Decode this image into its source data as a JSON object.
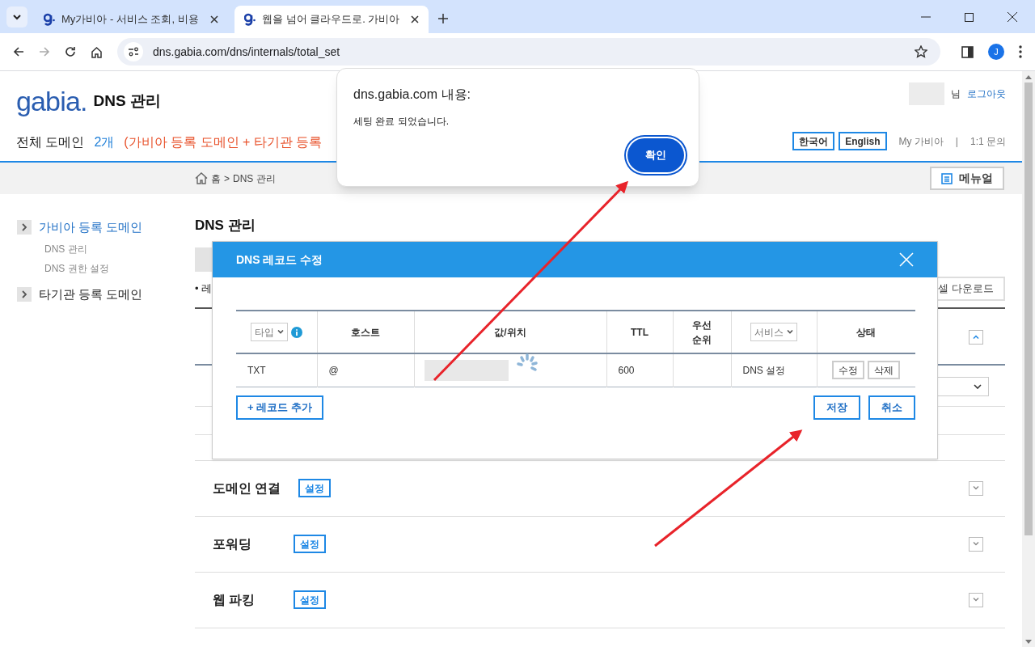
{
  "browser": {
    "tabs": [
      {
        "title": "My가비아 - 서비스 조회, 비용",
        "selected": false
      },
      {
        "title": "웹을 넘어 클라우드로. 가비아",
        "selected": true
      }
    ],
    "url": "dns.gabia.com/dns/internals/total_set",
    "avatar": "J"
  },
  "header": {
    "logo": "gabia.",
    "title": "DNS 관리",
    "user_suffix": "님",
    "logout": "로그아웃"
  },
  "summary": {
    "label": "전체 도메인",
    "count": "2개",
    "note": "(가비아 등록 도메인 + 타기관 등록"
  },
  "languages": [
    {
      "label": "한국어"
    },
    {
      "label": "English"
    }
  ],
  "links": [
    "My 가비아",
    "|",
    "1:1 문의"
  ],
  "breadcrumb": {
    "home": "홈",
    "separator": ">",
    "current": "DNS 관리"
  },
  "manual_button": "메뉴얼",
  "sidebar": [
    {
      "label": "가비아 등록 도메인",
      "selected": true,
      "children": [
        "DNS 관리",
        "DNS 권한 설정"
      ]
    },
    {
      "label": "타기관 등록 도메인",
      "selected": false
    }
  ],
  "main": {
    "heading": "DNS 관리",
    "bullet_text": "• 레",
    "excel_button": "셀 다운로드",
    "sections": [
      {
        "title": "도메인 연결",
        "button": "설정"
      },
      {
        "title": "포워딩",
        "button": "설정"
      },
      {
        "title": "웹 파킹",
        "button": "설정"
      }
    ]
  },
  "dialog": {
    "title": "DNS 레코드 수정",
    "columns": [
      {
        "kind": "select",
        "label": "타입"
      },
      {
        "kind": "text",
        "label": "호스트"
      },
      {
        "kind": "text",
        "label": "값/위치"
      },
      {
        "kind": "text",
        "label": "TTL"
      },
      {
        "kind": "text",
        "label": "우선\n순위"
      },
      {
        "kind": "select",
        "label": "서비스"
      },
      {
        "kind": "text",
        "label": "상태"
      }
    ],
    "rows": [
      {
        "type": "TXT",
        "host": "@",
        "ttl": "600",
        "service": "DNS 설정",
        "actions": [
          "수정",
          "삭제"
        ]
      }
    ],
    "add_button": "+ 레코드 추가",
    "save_button": "저장",
    "cancel_button": "취소"
  },
  "alert": {
    "origin": "dns.gabia.com 내용:",
    "message": "세팅 완료 되었습니다.",
    "ok_button": "확인"
  }
}
